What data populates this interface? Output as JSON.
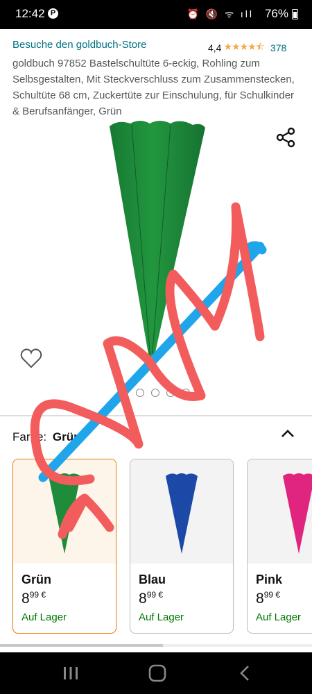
{
  "status_bar": {
    "time": "12:42",
    "notification_icon": "pinterest-icon",
    "notification_glyph": "P",
    "system_icons": "⏰ 🔇 ᯤ ıll",
    "battery": "76%"
  },
  "product": {
    "store_link": "Besuche den goldbuch-Store",
    "rating_value": "4,4",
    "rating_stars": "★★★★⯪",
    "rating_fraction": 0.88,
    "rating_count": "378",
    "title": "goldbuch 97852 Bastelschultüte 6-eckig, Rohling zum Selbsgestalten, Mit Steckverschluss zum Zusammenstecken, Schultüte 68 cm, Zuckertüte zur Einschulung, für Schulkinder & Berufsanfänger, Grün",
    "image_color": "#1f8c3c",
    "image_dots_count": 4,
    "image_dot_active": 1
  },
  "variation": {
    "label": "Farbe:",
    "selected": "Grün"
  },
  "swatches": [
    {
      "name": "Grün",
      "price_main": "8",
      "price_fraction": "99 €",
      "stock": "Auf Lager",
      "color": "#1f8c3c",
      "selected": true
    },
    {
      "name": "Blau",
      "price_main": "8",
      "price_fraction": "99 €",
      "stock": "Auf Lager",
      "color": "#1c49a8",
      "selected": false
    },
    {
      "name": "Pink",
      "price_main": "8",
      "price_fraction": "99 €",
      "stock": "Auf Lager",
      "color": "#e0257f",
      "selected": false
    }
  ],
  "colors": {
    "link": "#007185",
    "star": "#f3a847",
    "in_stock": "#007600",
    "selected_border": "#e77600",
    "annotation_red": "#f25c5c",
    "annotation_blue": "#1ea5ea"
  },
  "nav_bar": {
    "recent": "recent-apps-icon",
    "home": "home-icon",
    "back": "back-icon"
  }
}
